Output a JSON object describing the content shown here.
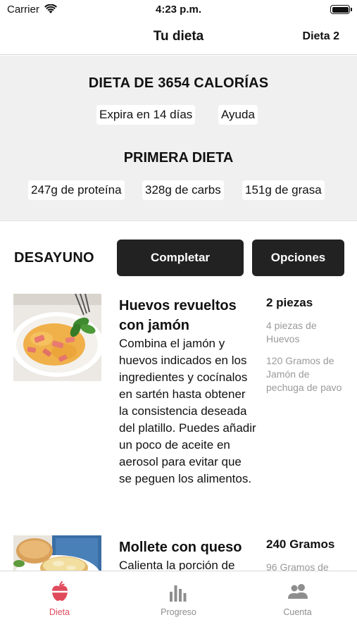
{
  "status_bar": {
    "carrier": "Carrier",
    "time": "4:23 p.m."
  },
  "nav": {
    "title": "Tu dieta",
    "right_action": "Dieta 2"
  },
  "summary": {
    "calories_title": "DIETA DE 3654 CALORÍAS",
    "expires": "Expira en 14 días",
    "help": "Ayuda",
    "diet_name": "PRIMERA DIETA",
    "macros": {
      "protein": "247g de proteína",
      "carbs": "328g de carbs",
      "fat": "151g de grasa"
    }
  },
  "meal": {
    "name": "DESAYUNO",
    "complete_label": "Completar",
    "options_label": "Opciones"
  },
  "foods": [
    {
      "title": "Huevos revueltos con jamón",
      "description": "Combina el jamón y huevos indicados en los ingredientes y cocínalos en sartén hasta obtener la consistencia deseada del platillo. Puedes añadir un poco de aceite en aerosol para evitar que se peguen los alimentos.",
      "quantity": "2 piezas",
      "ingredients": [
        "4 piezas de Huevos",
        "120 Gramos de Jamón de pechuga de pavo"
      ]
    },
    {
      "title": "Mollete con queso",
      "description": "Calienta la porción de",
      "quantity": "240 Gramos",
      "ingredients": [
        "96 Gramos de"
      ]
    }
  ],
  "tabs": [
    {
      "label": "Dieta",
      "icon": "apple-icon",
      "active": true
    },
    {
      "label": "Progreso",
      "icon": "bar-chart-icon",
      "active": false
    },
    {
      "label": "Cuenta",
      "icon": "people-icon",
      "active": false
    }
  ],
  "colors": {
    "accent": "#e04b5c",
    "button_bg": "#222222",
    "summary_bg": "#f0f0f0",
    "muted_text": "#9a9a9a"
  }
}
